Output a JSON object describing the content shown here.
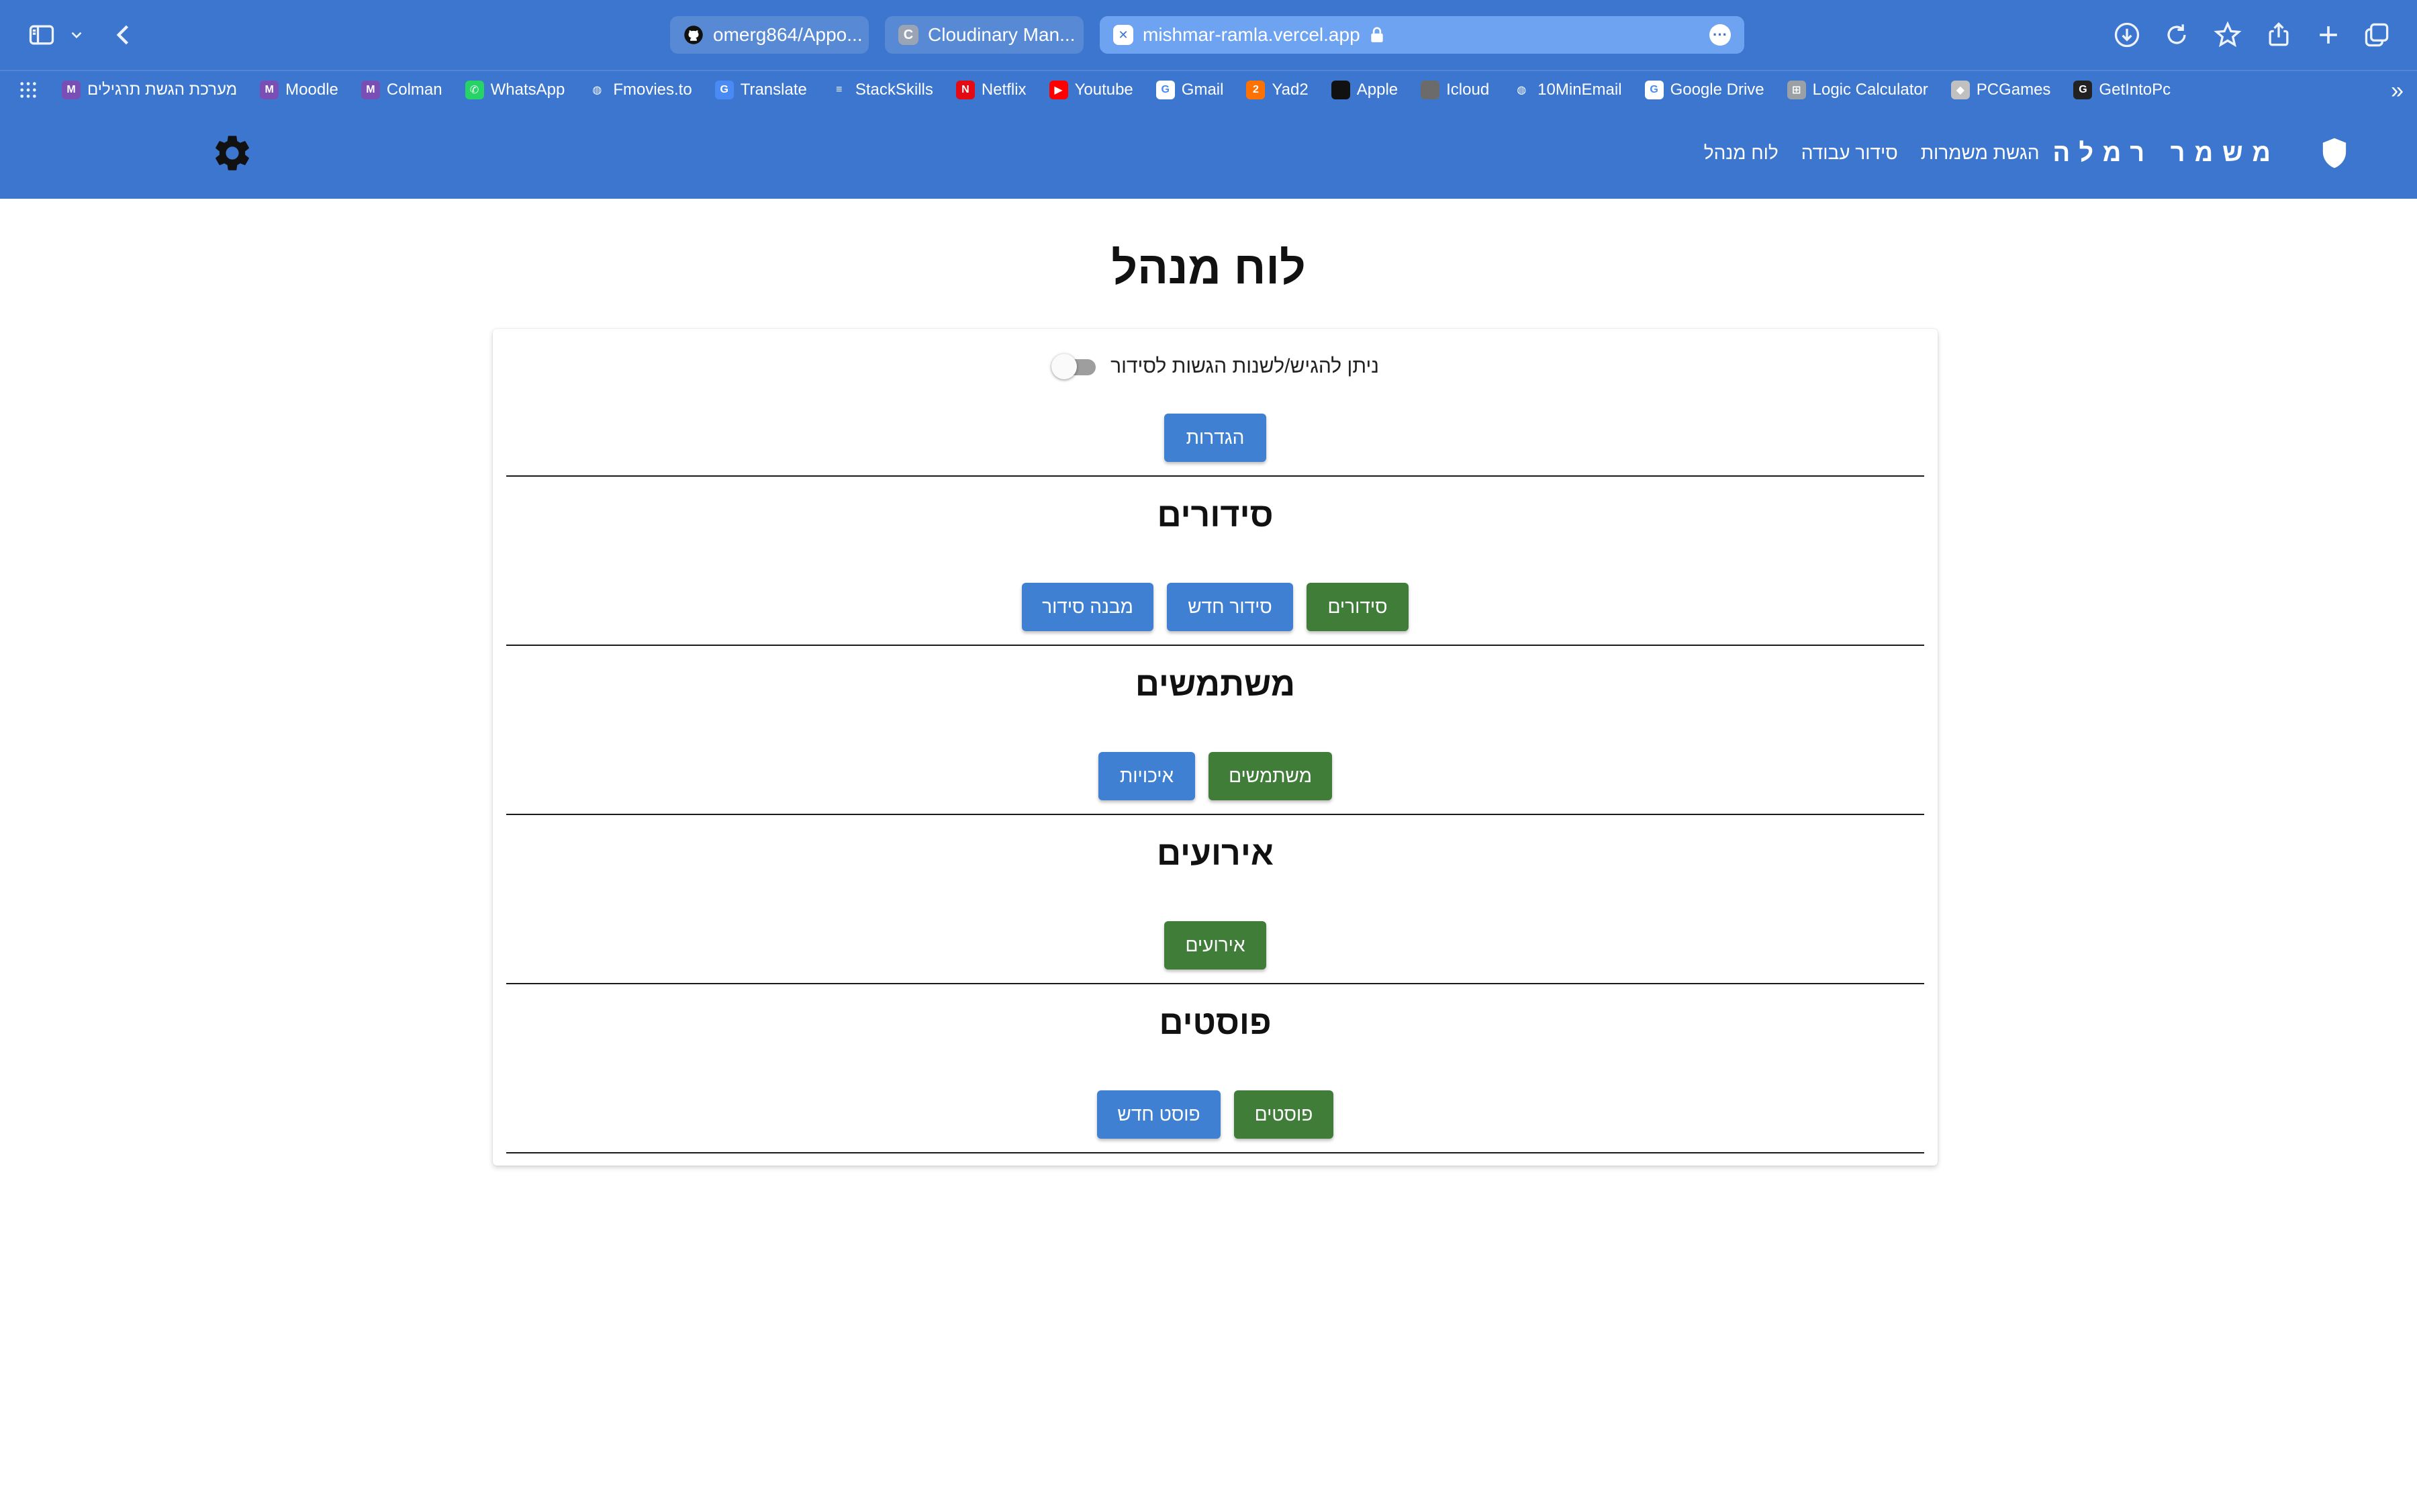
{
  "browser": {
    "tabs": [
      {
        "title": "omerg864/Appo..."
      },
      {
        "title": "Cloudinary Man..."
      }
    ],
    "address": "mishmar-ramla.vercel.app",
    "bookmarks": [
      {
        "label": "מערכת הגשת תרגילים",
        "icon": "moodle-icon",
        "color": "#7a4fb5"
      },
      {
        "label": "Moodle",
        "icon": "moodle-icon",
        "color": "#7a4fb5"
      },
      {
        "label": "Colman",
        "icon": "moodle-icon",
        "color": "#7a4fb5"
      },
      {
        "label": "WhatsApp",
        "icon": "whatsapp-icon",
        "color": "#25d366"
      },
      {
        "label": "Fmovies.to",
        "icon": "globe-icon",
        "color": "#3c76cf"
      },
      {
        "label": "Translate",
        "icon": "translate-icon",
        "color": "#4a8af4"
      },
      {
        "label": "StackSkills",
        "icon": "stackskills-icon",
        "color": "#3c76cf"
      },
      {
        "label": "Netflix",
        "icon": "netflix-icon",
        "color": "#e50914"
      },
      {
        "label": "Youtube",
        "icon": "youtube-icon",
        "color": "#ff0000"
      },
      {
        "label": "Gmail",
        "icon": "google-icon",
        "color": "#ffffff"
      },
      {
        "label": "Yad2",
        "icon": "yad2-icon",
        "color": "#ff7100"
      },
      {
        "label": "Apple",
        "icon": "apple-icon",
        "color": "#111111"
      },
      {
        "label": "Icloud",
        "icon": "apple-icon",
        "color": "#6b6b6b"
      },
      {
        "label": "10MinEmail",
        "icon": "globe-icon",
        "color": "#3c76cf"
      },
      {
        "label": "Google Drive",
        "icon": "google-icon",
        "color": "#ffffff"
      },
      {
        "label": "Logic Calculator",
        "icon": "calculator-icon",
        "color": "#9aa0a6"
      },
      {
        "label": "PCGames",
        "icon": "gamepad-icon",
        "color": "#c0c0c0"
      },
      {
        "label": "GetIntoPc",
        "icon": "getintopc-icon",
        "color": "#222222"
      }
    ]
  },
  "nav": {
    "brand": "משמר רמלה",
    "links": [
      "הגשת משמרות",
      "סידור עבודה",
      "לוח מנהל"
    ]
  },
  "page": {
    "title": "לוח מנהל",
    "toggle_label": "ניתן להגיש/לשנות הגשות לסידור",
    "toggle_on": false,
    "settings_button": "הגדרות",
    "sections": [
      {
        "title": "סידורים",
        "buttons": [
          "סידורים",
          "סידור חדש",
          "מבנה סידור"
        ]
      },
      {
        "title": "משתמשים",
        "buttons": [
          "משתמשים",
          "איכויות"
        ]
      },
      {
        "title": "אירועים",
        "buttons": [
          "אירועים"
        ]
      },
      {
        "title": "פוסטים",
        "buttons": [
          "פוסטים",
          "פוסט חדש"
        ]
      }
    ]
  },
  "colors": {
    "chrome": "#3c76cf",
    "primary_button": "#3f80d2",
    "success_button": "#3f7d39"
  }
}
